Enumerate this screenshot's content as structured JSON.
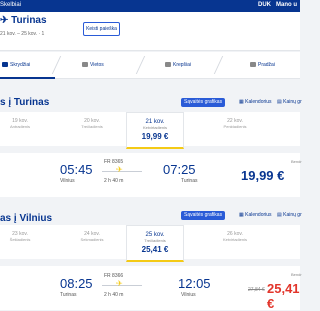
{
  "topbar": {
    "brand": "Skelbiai",
    "lang": "DUK",
    "account": "Mano u"
  },
  "header": {
    "title": "Turinas",
    "meta": "21 kov. – 25 kov. · 1",
    "change_button": "Keisti paieška"
  },
  "steps": [
    {
      "label": "Skrydžiai",
      "active": true
    },
    {
      "label": "Vietos",
      "active": false
    },
    {
      "label": "Krepšiai",
      "active": false
    },
    {
      "label": "Pradžai",
      "active": false
    }
  ],
  "outbound": {
    "title": "s į Turinas",
    "actions": {
      "fares": "Sąvaitės grafikas",
      "calendar": "Kalendorius",
      "chart": "Kainų gr"
    },
    "dates": [
      {
        "d": "19 kov.",
        "w": "Antradienis"
      },
      {
        "d": "20 kov.",
        "w": "Trečiadienis"
      },
      {
        "d": "21 kov.",
        "w": "Ketvirtadienis",
        "p": "19,99 €",
        "selected": true
      },
      {
        "d": "22 kov.",
        "w": "Penktadienis"
      }
    ],
    "flight": {
      "dep_time": "05:45",
      "dep_city": "Vilnius",
      "arr_time": "07:25",
      "arr_city": "Turinas",
      "fno": "FR 8365",
      "dur": "2 h 40 m",
      "price": "19,99 €",
      "from": "Bendr"
    }
  },
  "inbound": {
    "title": "as į Vilnius",
    "actions": {
      "fares": "Sąvaitės grafikas",
      "calendar": "Kalendorius",
      "chart": "Kainų gr"
    },
    "dates": [
      {
        "d": "23 kov.",
        "w": "Šeštadienis"
      },
      {
        "d": "24 kov.",
        "w": "Sekmadienis"
      },
      {
        "d": "25 kov.",
        "w": "Trečiadienis",
        "p": "25,41 €",
        "selected": true
      },
      {
        "d": "26 kov.",
        "w": "Ketvirtadienis"
      }
    ],
    "flight": {
      "dep_time": "08:25",
      "dep_city": "Turinas",
      "arr_time": "12:05",
      "arr_city": "Vilnius",
      "fno": "FR 8366",
      "dur": "2 h 40 m",
      "price": "25,41 €",
      "old_price": "27,84 €",
      "from": "Bendr"
    }
  }
}
